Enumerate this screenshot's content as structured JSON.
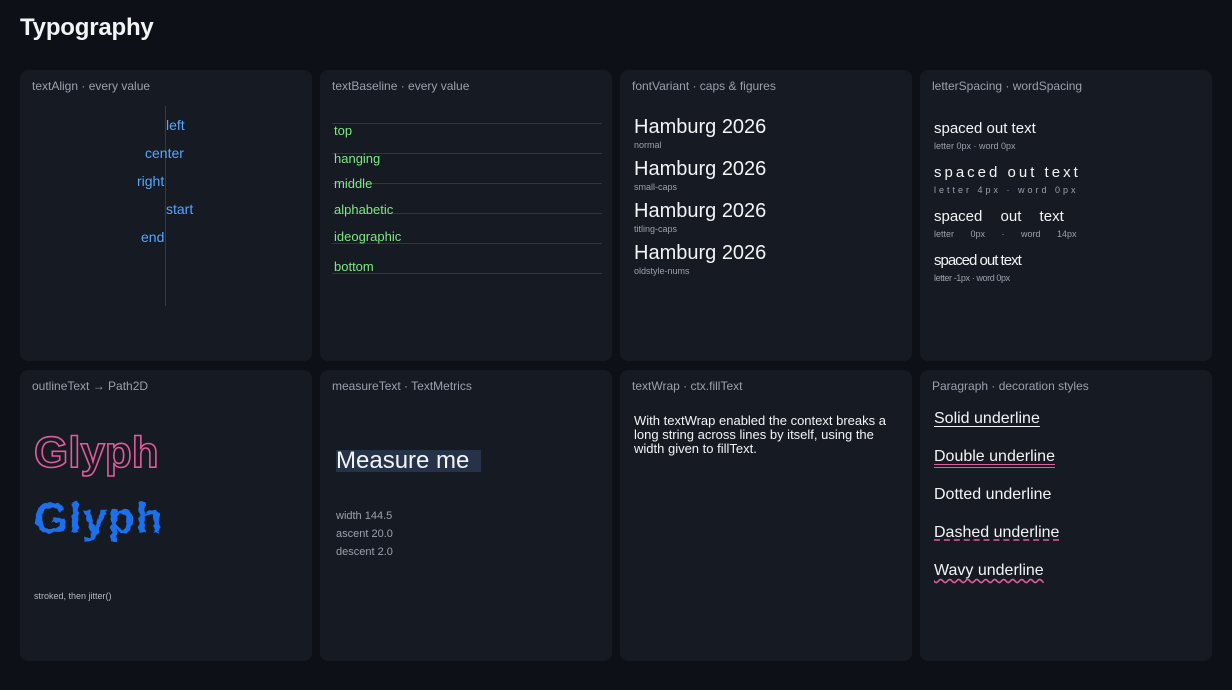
{
  "page": {
    "title": "Typography"
  },
  "cards": {
    "text_align": {
      "title": "textAlign · every value",
      "values": [
        "left",
        "center",
        "right",
        "start",
        "end"
      ]
    },
    "text_baseline": {
      "title": "textBaseline · every value",
      "values": [
        "top",
        "hanging",
        "middle",
        "alphabetic",
        "ideographic",
        "bottom"
      ]
    },
    "font_variant": {
      "title": "fontVariant · caps & figures",
      "sample": "Hamburg 2026",
      "variants": [
        "normal",
        "small-caps",
        "titling-caps",
        "oldstyle-nums"
      ]
    },
    "spacing": {
      "title": "letterSpacing · wordSpacing",
      "sample": "spaced out text",
      "rows": [
        {
          "caption": "letter 0px · word 0px"
        },
        {
          "caption": "letter 4px · word 0px"
        },
        {
          "caption": "letter 0px · word 14px"
        },
        {
          "caption": "letter -1px · word 0px"
        }
      ]
    },
    "outline": {
      "title": "outlineText → Path2D",
      "glyph": "Glyph",
      "note": "stroked, then jitter()"
    },
    "measure": {
      "title": "measureText · TextMetrics",
      "sample": "Measure me",
      "width": "width 144.5",
      "ascent": "ascent 20.0",
      "descent": "descent 2.0"
    },
    "wrap": {
      "title": "textWrap · ctx.fillText",
      "text": "With textWrap enabled the context breaks a long string across lines by itself, using the width given to fillText."
    },
    "decorations": {
      "title": "Paragraph · decoration styles",
      "items": [
        "Solid underline",
        "Double underline",
        "Dotted underline",
        "Dashed underline",
        "Wavy underline"
      ]
    }
  }
}
